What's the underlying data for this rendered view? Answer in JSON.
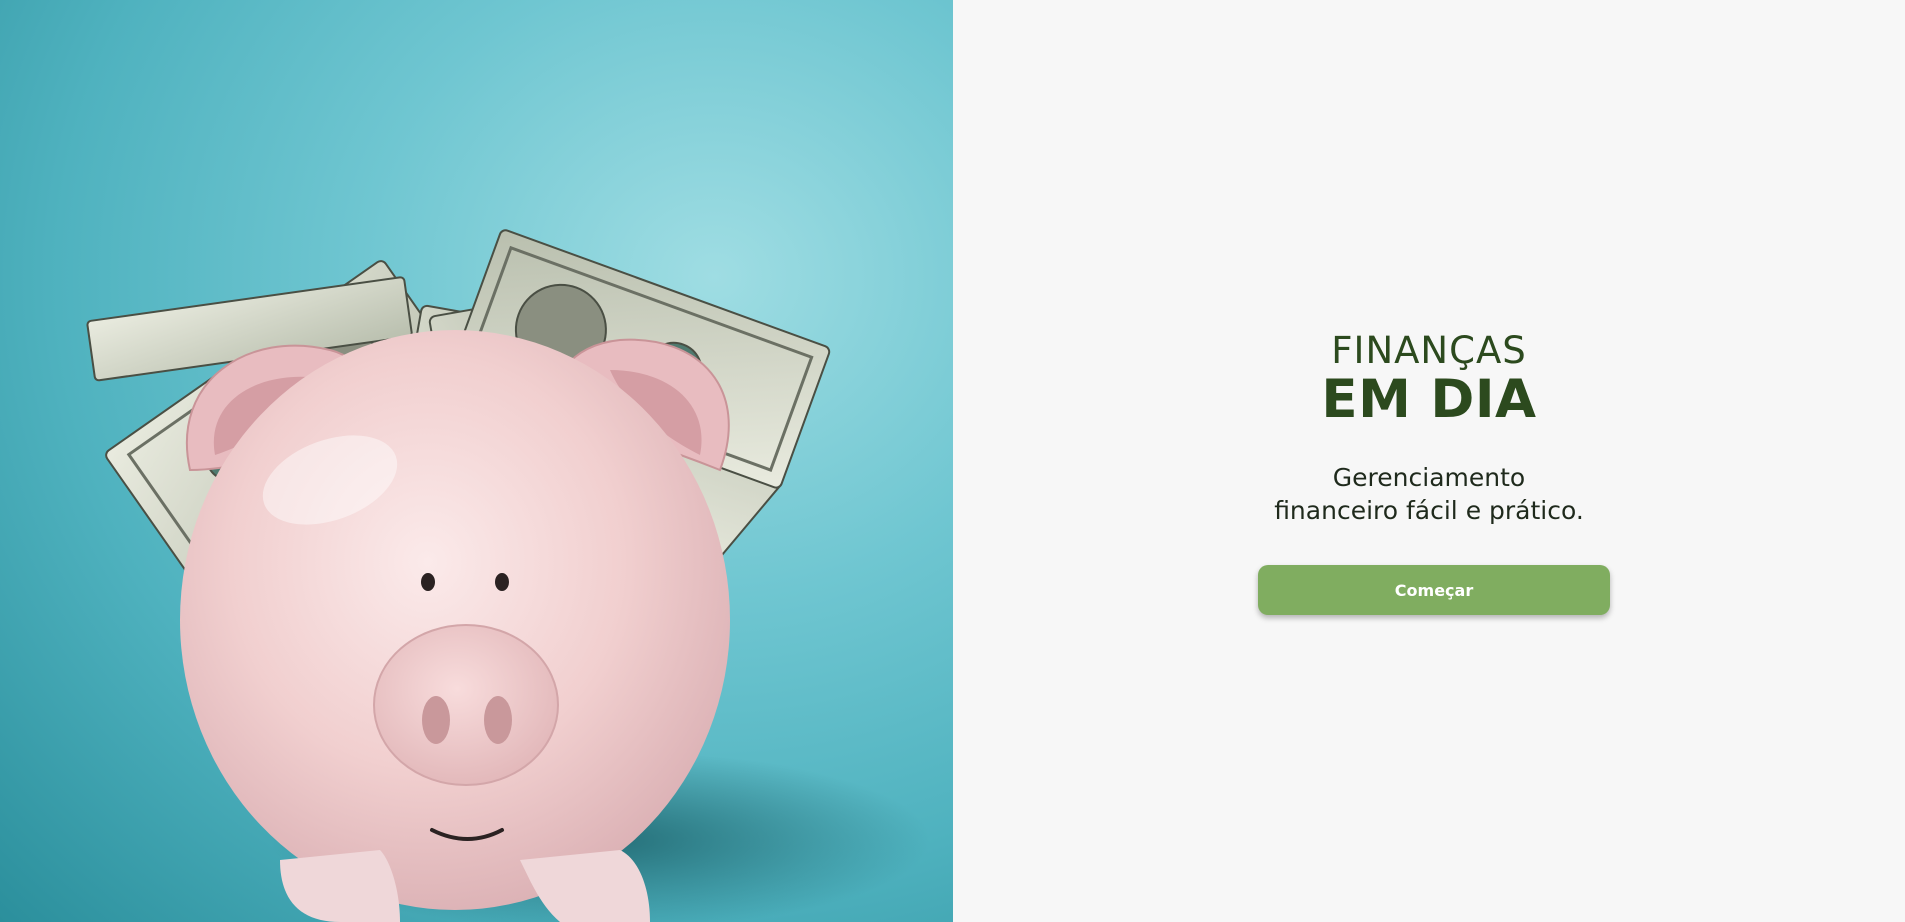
{
  "brand": {
    "line1": "FINANÇAS",
    "line2": "EM DIA",
    "color": "#2c4a1e"
  },
  "tagline": {
    "line1": "Gerenciamento",
    "line2": "financeiro fácil e prático."
  },
  "cta": {
    "label": "Começar",
    "color": "#80ad60"
  },
  "hero": {
    "alt": "piggy bank with dollar bills",
    "background_color": "#6fc6d1"
  }
}
